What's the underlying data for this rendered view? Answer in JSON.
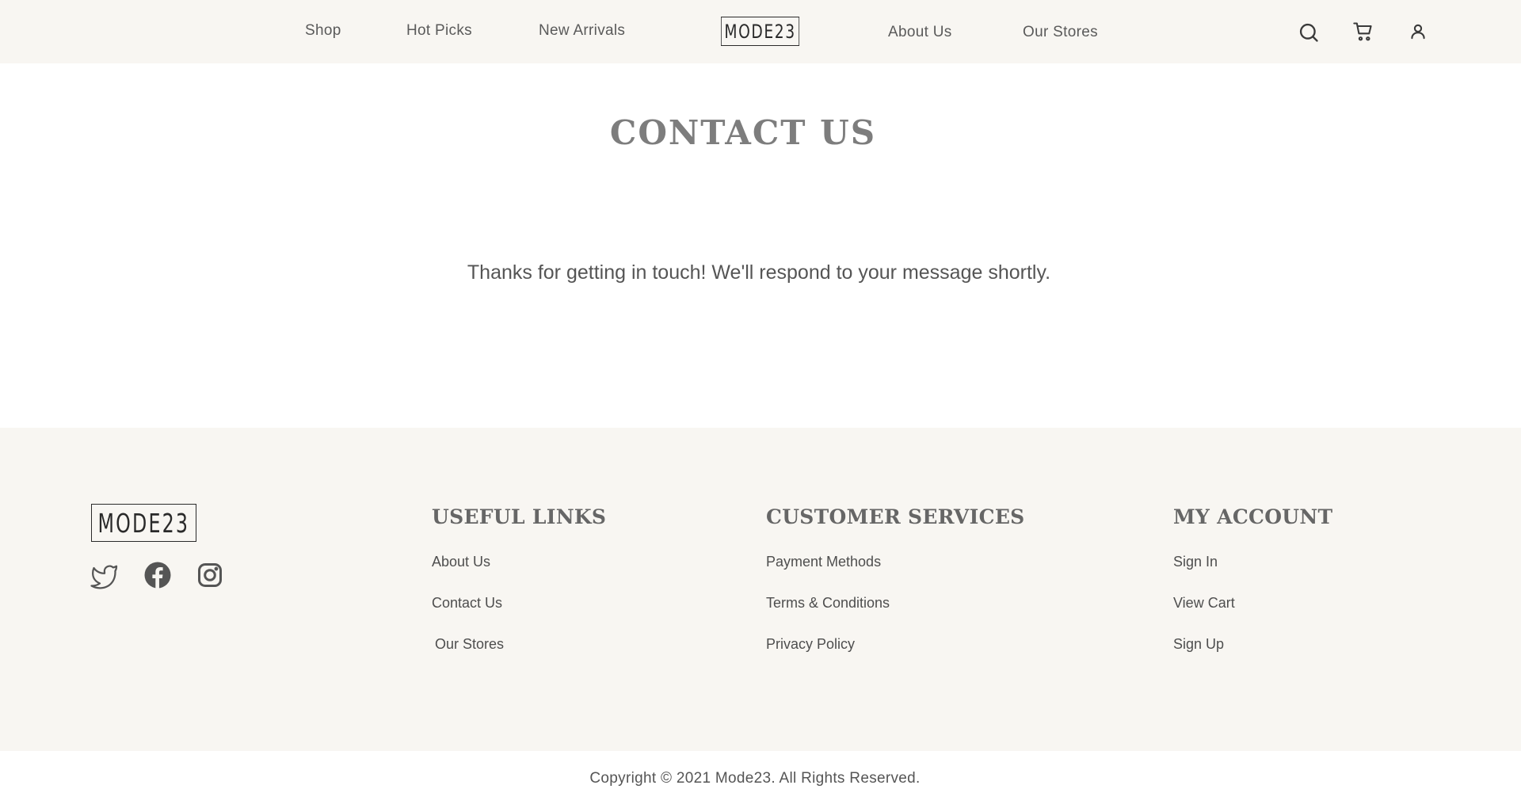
{
  "header": {
    "nav_left": [
      "Shop",
      "Hot Picks",
      "New Arrivals"
    ],
    "logo": "MODE23",
    "nav_right": [
      "About Us",
      "Our Stores"
    ],
    "icons": [
      "search-icon",
      "cart-icon",
      "user-icon"
    ]
  },
  "main": {
    "title": "CONTACT US",
    "message": "Thanks for getting in touch! We'll respond to your message shortly."
  },
  "footer": {
    "logo": "MODE23",
    "social": [
      "twitter-icon",
      "facebook-icon",
      "instagram-icon"
    ],
    "columns": [
      {
        "title": "USEFUL LINKS",
        "links": [
          "About Us",
          "Contact Us",
          "Our Stores"
        ]
      },
      {
        "title": "CUSTOMER SERVICES",
        "links": [
          "Payment Methods",
          "Terms & Conditions",
          "Privacy Policy"
        ]
      },
      {
        "title": "MY ACCOUNT",
        "links": [
          "Sign In",
          "View Cart",
          "Sign Up"
        ]
      }
    ],
    "copyright": "Copyright © 2021 Mode23. All Rights Reserved."
  },
  "colors": {
    "band_background": "#f8f6f2",
    "text": "#4a4a4a",
    "title": "#7d7d7d"
  }
}
